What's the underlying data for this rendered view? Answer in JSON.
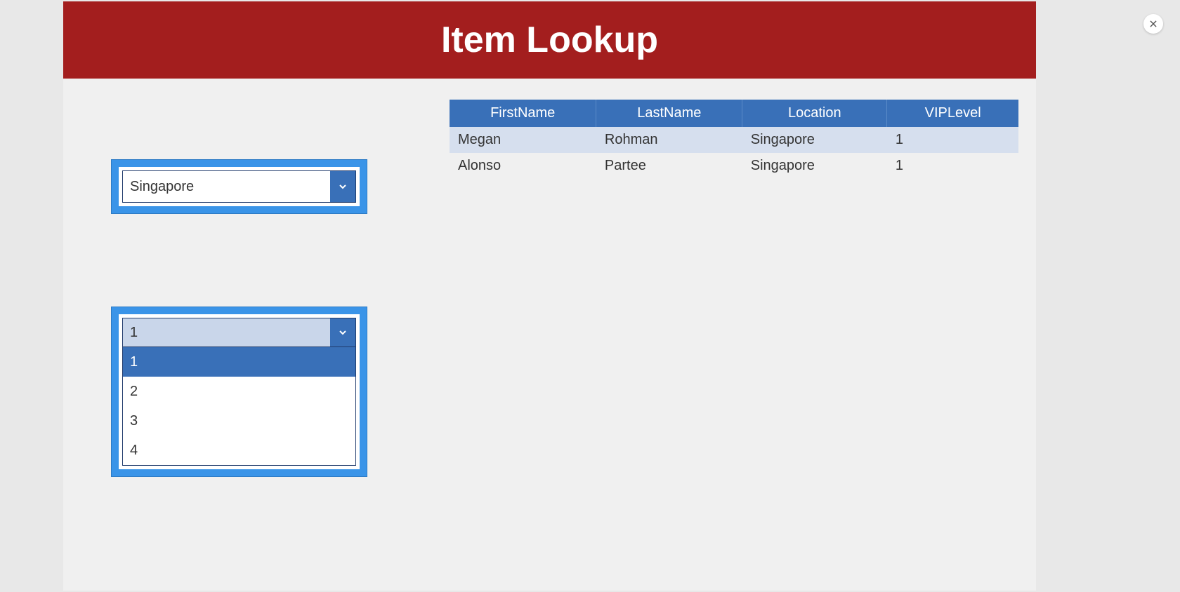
{
  "header": {
    "title": "Item Lookup"
  },
  "filters": {
    "location": {
      "selected": "Singapore"
    },
    "vip_level": {
      "selected": "1",
      "options": [
        "1",
        "2",
        "3",
        "4"
      ]
    }
  },
  "table": {
    "columns": [
      "FirstName",
      "LastName",
      "Location",
      "VIPLevel"
    ],
    "rows": [
      {
        "FirstName": "Megan",
        "LastName": "Rohman",
        "Location": "Singapore",
        "VIPLevel": "1"
      },
      {
        "FirstName": "Alonso",
        "LastName": "Partee",
        "Location": "Singapore",
        "VIPLevel": "1"
      }
    ]
  }
}
